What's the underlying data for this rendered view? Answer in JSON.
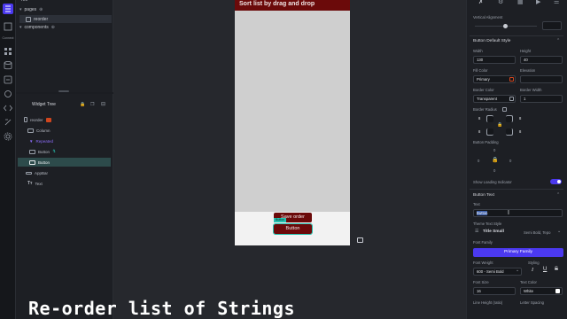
{
  "rail": {
    "labels": [
      "Connect"
    ]
  },
  "file_tree": {
    "root": "res",
    "pages": "pages",
    "reorder": "reorder",
    "components": "components"
  },
  "widget_tree": {
    "title": "Widget Tree",
    "rows": [
      "reorder",
      "Column",
      "Repeated",
      "Button",
      "Button",
      "AppBar",
      "Text"
    ]
  },
  "canvas": {
    "appbar_title": "Sort list by drag and drop",
    "save_button": "Save order",
    "button": "Button",
    "button_tag": "Button"
  },
  "props": {
    "vertical_alignment": "Vertical Alignment",
    "default_style": "Button Default Style",
    "width_label": "Width",
    "width_value": "130",
    "height_label": "Height",
    "height_value": "40",
    "fill_color_label": "Fill Color",
    "fill_color_value": "Primary",
    "elevation_label": "Elevation",
    "border_color_label": "Border Color",
    "border_color_value": "Transparent",
    "border_width_label": "Border Width",
    "border_width_value": "1",
    "border_radius_label": "Border Radius",
    "radius_values": [
      "8",
      "8",
      "8",
      "8"
    ],
    "button_padding": "Button Padding",
    "padding_values": [
      "0",
      "0",
      "0",
      "0"
    ],
    "loading_indicator": "Show Loading Indicator",
    "button_text_section": "Button Text",
    "text_label": "Text",
    "text_value": "Button",
    "theme_text_style": "Theme Text Style",
    "theme_value": "Title Small",
    "theme_font_hint": "Semi Bold, Tepo",
    "font_family_label": "Font Family",
    "font_family_value": "Primary Family",
    "font_weight_label": "Font Weight",
    "font_weight_value": "600 - Semi Bold",
    "styling_label": "Styling",
    "font_size_label": "Font Size",
    "font_size_value": "16",
    "text_color_label": "Text Color",
    "text_color_value": "White",
    "line_height_label": "Line Height (ratio)",
    "letter_spacing_label": "Letter Spacing"
  },
  "caption": "Re-order list of Strings",
  "colors": {
    "accent": "#4b39ef",
    "appbar": "#6b0a0a",
    "selection": "#27c2b0",
    "panel": "#1d1f24"
  }
}
